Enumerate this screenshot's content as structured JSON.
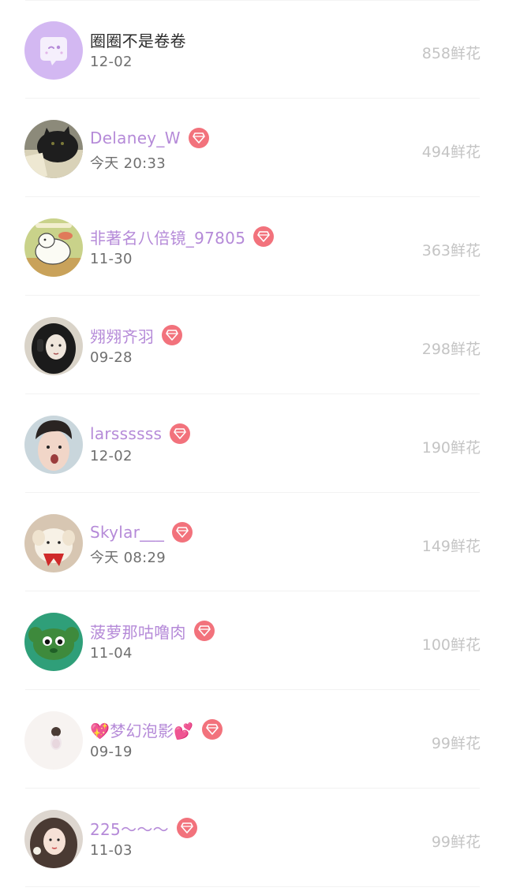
{
  "ranking": [
    {
      "name": "圈圈不是卷卷",
      "time": "12-02",
      "flowers": "858鲜花",
      "vip": false,
      "name_color": "#2a2a2a",
      "avatar": "chat-bubble-avatar",
      "avatar_bg": "#d3b8f2"
    },
    {
      "name": "Delaney_W",
      "time": "今天 20:33",
      "flowers": "494鲜花",
      "vip": true,
      "name_color": "#b58ad8",
      "avatar": "cat-photo-avatar",
      "avatar_bg": "#5a5a4e"
    },
    {
      "name": "非著名八倍镜_97805",
      "time": "11-30",
      "flowers": "363鲜花",
      "vip": true,
      "name_color": "#b58ad8",
      "avatar": "cartoon-dog-avatar",
      "avatar_bg": "#c9d28a"
    },
    {
      "name": "翙翙齐羽",
      "time": "09-28",
      "flowers": "298鲜花",
      "vip": true,
      "name_color": "#b58ad8",
      "avatar": "girl-headphones-avatar",
      "avatar_bg": "#2b2b2b"
    },
    {
      "name": "larssssss",
      "time": "12-02",
      "flowers": "190鲜花",
      "vip": true,
      "name_color": "#b58ad8",
      "avatar": "boy-photo-avatar",
      "avatar_bg": "#c9d6dc"
    },
    {
      "name": "Skylar___",
      "time": "今天 08:29",
      "flowers": "149鲜花",
      "vip": true,
      "name_color": "#b58ad8",
      "avatar": "plush-toy-avatar",
      "avatar_bg": "#d7c6b2"
    },
    {
      "name": "菠萝那咕噜肉",
      "time": "11-04",
      "flowers": "100鲜花",
      "vip": true,
      "name_color": "#b58ad8",
      "avatar": "green-plush-avatar",
      "avatar_bg": "#2f9f79"
    },
    {
      "name": "💖梦幻泡影💕",
      "time": "09-19",
      "flowers": "99鲜花",
      "vip": true,
      "name_color": "#b58ad8",
      "avatar": "small-figure-avatar",
      "avatar_bg": "#f7f3f1"
    },
    {
      "name": "225～～～",
      "time": "11-03",
      "flowers": "99鲜花",
      "vip": true,
      "name_color": "#b58ad8",
      "avatar": "girl-portrait-avatar",
      "avatar_bg": "#4a3a33"
    }
  ],
  "badge_color": "#f2727c"
}
